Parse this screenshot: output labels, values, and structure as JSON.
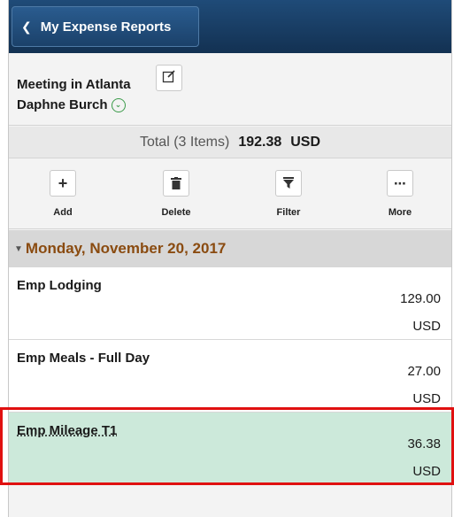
{
  "topbar": {
    "back_label": "My Expense Reports"
  },
  "header": {
    "report_title": "Meeting in Atlanta",
    "employee_name": "Daphne Burch"
  },
  "totals": {
    "label": "Total (3 Items)",
    "amount": "192.38",
    "currency": "USD"
  },
  "toolbar": {
    "add_label": "Add",
    "delete_label": "Delete",
    "filter_label": "Filter",
    "more_label": "More"
  },
  "group": {
    "date": "Monday, November 20, 2017"
  },
  "expenses": [
    {
      "description": "Emp Lodging",
      "amount": "129.00",
      "currency": "USD"
    },
    {
      "description": "Emp Meals - Full Day",
      "amount": "27.00",
      "currency": "USD"
    },
    {
      "description": "Emp Mileage T1",
      "amount": "36.38",
      "currency": "USD"
    }
  ],
  "colors": {
    "topbar": "#163a5f",
    "date_text": "#8a4b10",
    "selected_row": "#cce9da",
    "highlight_box": "#e01010"
  }
}
